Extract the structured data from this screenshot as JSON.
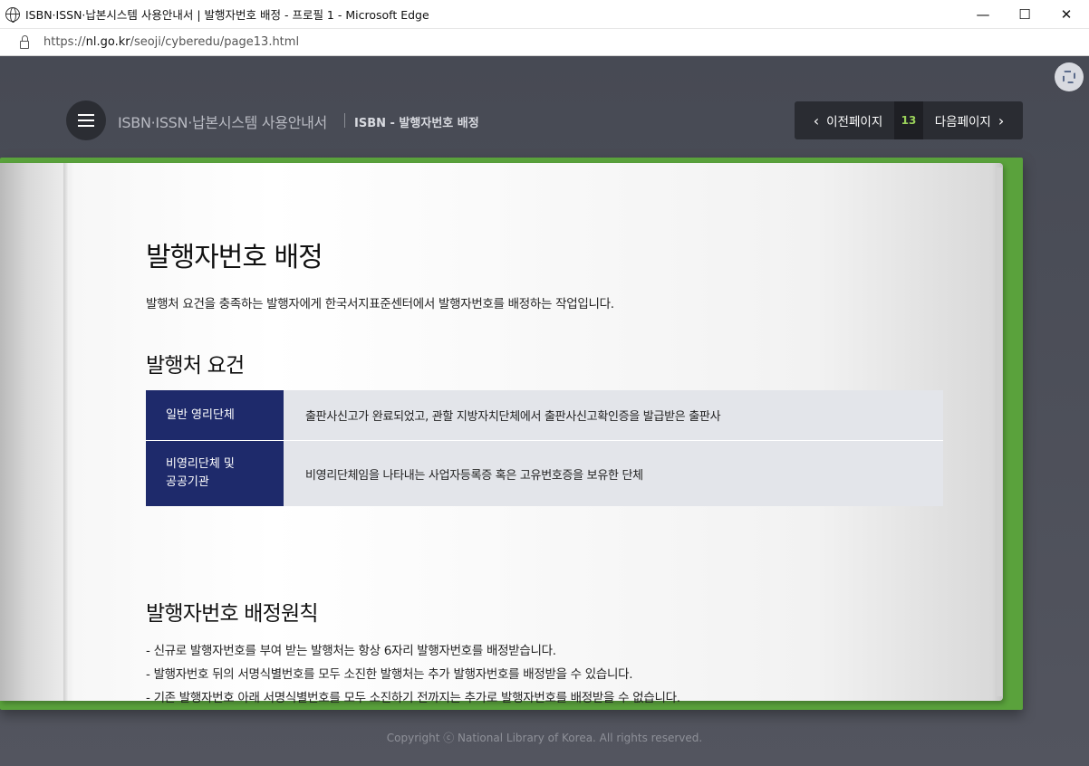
{
  "window": {
    "title": "ISBN·ISSN·납본시스템 사용안내서 | 발행자번호 배정 - 프로필 1 - Microsoft Edge",
    "minimize": "—",
    "maximize": "☐",
    "close": "✕"
  },
  "address": {
    "prefix": "https://",
    "domain": "nl.go.kr",
    "path": "/seoji/cyberedu/page13.html"
  },
  "header": {
    "site_title": "ISBN·ISSN·납본시스템 사용안내서",
    "section_title": "ISBN - 발행자번호 배정"
  },
  "pager": {
    "prev_label": "이전페이지",
    "page_number": "13",
    "next_label": "다음페이지"
  },
  "main": {
    "title": "발행자번호 배정",
    "intro": "발행처 요건을 충족하는 발행자에게 한국서지표준센터에서 발행자번호를 배정하는 작업입니다.",
    "requirements_heading": "발행처 요건",
    "requirements": [
      {
        "label_lines": [
          "일반 영리단체"
        ],
        "desc": "출판사신고가 완료되었고, 관할 지방자치단체에서 출판사신고확인증을 발급받은 출판사"
      },
      {
        "label_lines": [
          "비영리단체 및",
          "공공기관"
        ],
        "desc": "비영리단체임을 나타내는 사업자등록증 혹은 고유번호증을 보유한 단체"
      }
    ],
    "principles_heading": "발행자번호 배정원칙",
    "principles": [
      "- 신규로 발행자번호를 부여 받는 발행처는 항상 6자리 발행자번호를 배정받습니다.",
      "- 발행자번호 뒤의 서명식별번호를 모두 소진한 발행처는 추가 발행자번호를 배정받을 수 있습니다.",
      "- 기존 발행자번호 아래 서명식별번호를 모두 소진하기 전까지는 추가로 발행자번호를 배정받을 수 없습니다."
    ]
  },
  "footer": {
    "copyright": "Copyright ⓒ National Library of Korea. All rights reserved."
  },
  "colors": {
    "book_cover": "#5aa23c",
    "table_header": "#1e2a6b",
    "page_number": "#9ad15a",
    "background": "#4a4c56"
  }
}
